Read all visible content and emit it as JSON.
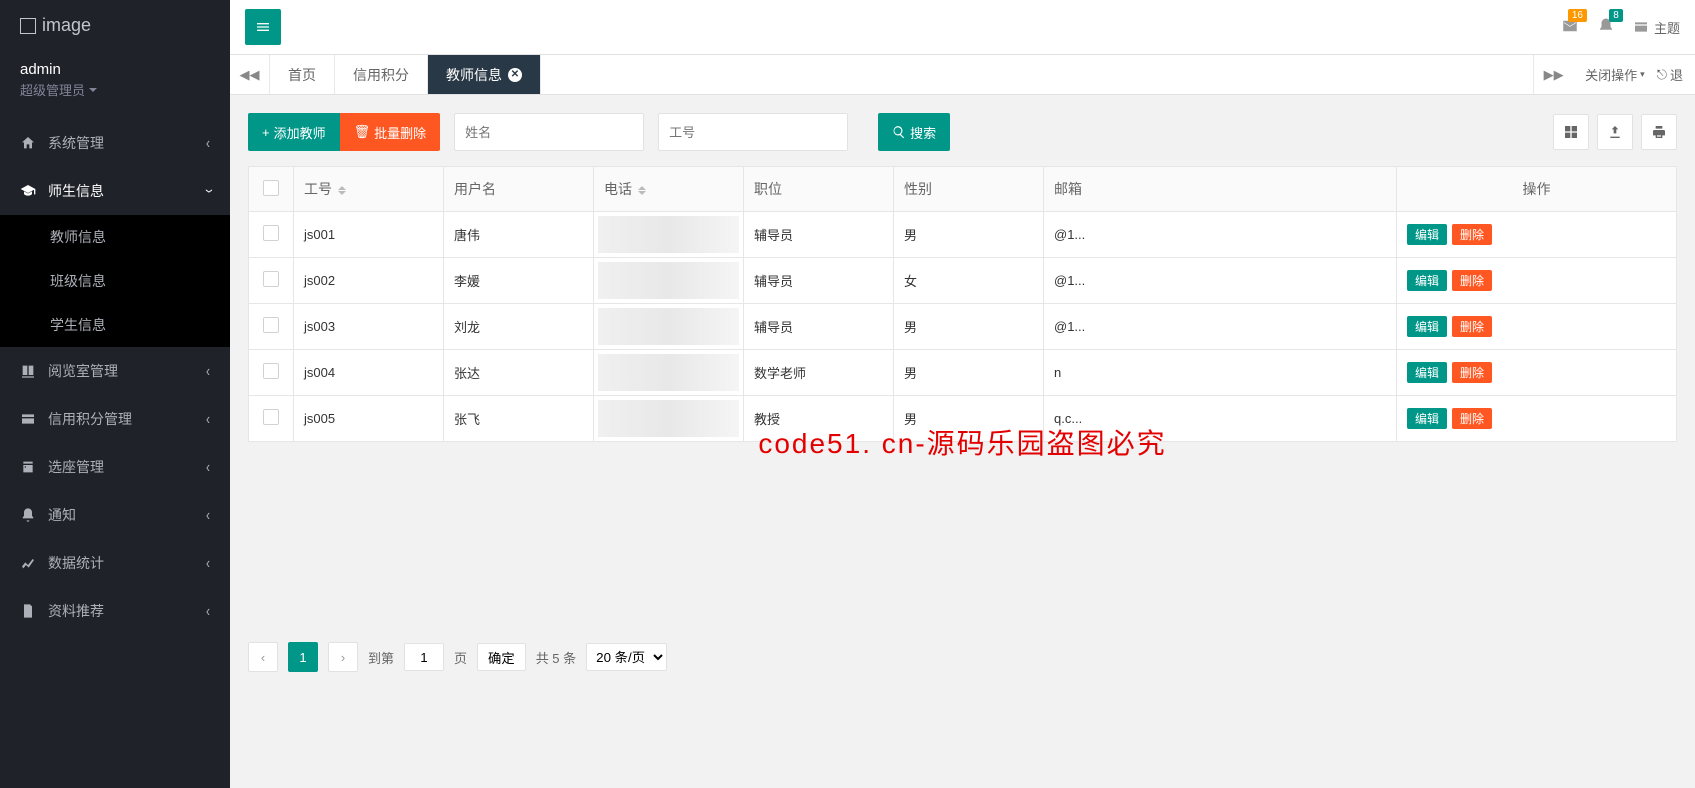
{
  "logo_text": "image",
  "user": {
    "name": "admin",
    "role": "超级管理员"
  },
  "sidebar": {
    "items": [
      {
        "icon": "home",
        "label": "系统管理"
      },
      {
        "icon": "cap",
        "label": "师生信息",
        "open": true,
        "children": [
          {
            "label": "教师信息"
          },
          {
            "label": "班级信息"
          },
          {
            "label": "学生信息"
          }
        ]
      },
      {
        "icon": "book",
        "label": "阅览室管理"
      },
      {
        "icon": "card",
        "label": "信用积分管理"
      },
      {
        "icon": "calendar",
        "label": "选座管理"
      },
      {
        "icon": "bell",
        "label": "通知"
      },
      {
        "icon": "chart",
        "label": "数据统计"
      },
      {
        "icon": "doc",
        "label": "资料推荐"
      }
    ]
  },
  "topbar": {
    "badge_mail": "16",
    "badge_bell": "8",
    "theme_label": "主题"
  },
  "tabs": {
    "items": [
      {
        "label": "首页",
        "active": false
      },
      {
        "label": "信用积分",
        "active": false
      },
      {
        "label": "教师信息",
        "active": true,
        "closeable": true
      }
    ],
    "close_action": "关闭操作",
    "exit_label": "退"
  },
  "toolbar": {
    "add_label": "添加教师",
    "batch_delete_label": "批量删除",
    "name_placeholder": "姓名",
    "id_placeholder": "工号",
    "search_label": "搜索"
  },
  "table": {
    "headers": {
      "id": "工号",
      "username": "用户名",
      "phone": "电话",
      "position": "职位",
      "gender": "性别",
      "email": "邮箱",
      "operate": "操作"
    },
    "edit_label": "编辑",
    "delete_label": "删除",
    "rows": [
      {
        "id": "js001",
        "username": "唐伟",
        "phone": "",
        "position": "辅导员",
        "gender": "男",
        "email": "@1..."
      },
      {
        "id": "js002",
        "username": "李媛",
        "phone": "",
        "position": "辅导员",
        "gender": "女",
        "email": "@1..."
      },
      {
        "id": "js003",
        "username": "刘龙",
        "phone": "",
        "position": "辅导员",
        "gender": "男",
        "email": "@1..."
      },
      {
        "id": "js004",
        "username": "张达",
        "phone": "",
        "position": "数学老师",
        "gender": "男",
        "email": "n"
      },
      {
        "id": "js005",
        "username": "张飞",
        "phone": "",
        "position": "教授",
        "gender": "男",
        "email": "q.c..."
      }
    ]
  },
  "pagination": {
    "goto_label": "到第",
    "page_value": "1",
    "page_unit": "页",
    "confirm": "确定",
    "total": "共 5 条",
    "per_page": "20 条/页"
  },
  "watermark": "code51. cn-源码乐园盗图必究"
}
